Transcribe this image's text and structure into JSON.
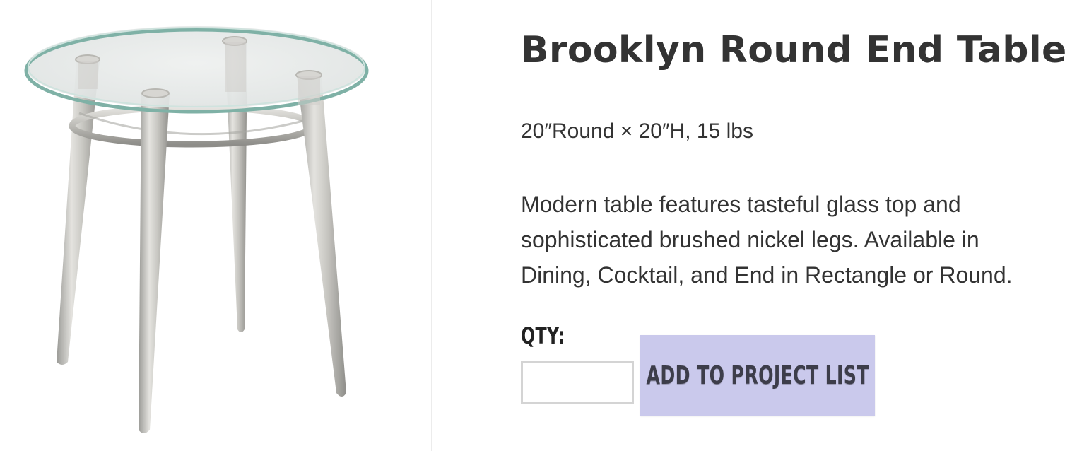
{
  "product": {
    "title": "Brooklyn Round End Table",
    "dimensions": "20″Round × 20″H, 15 lbs",
    "description_lines": [
      "Modern table features tasteful glass top and",
      "sophisticated brushed nickel legs. Available in",
      "Dining, Cocktail, and End in Rectangle or Round."
    ],
    "image_icon": "round-glass-end-table-photo"
  },
  "order": {
    "qty_label": "QTY:",
    "qty_value": "",
    "add_button_label": "ADD TO PROJECT LIST"
  },
  "colors": {
    "button_background": "#cac9ec",
    "text": "#333333"
  }
}
